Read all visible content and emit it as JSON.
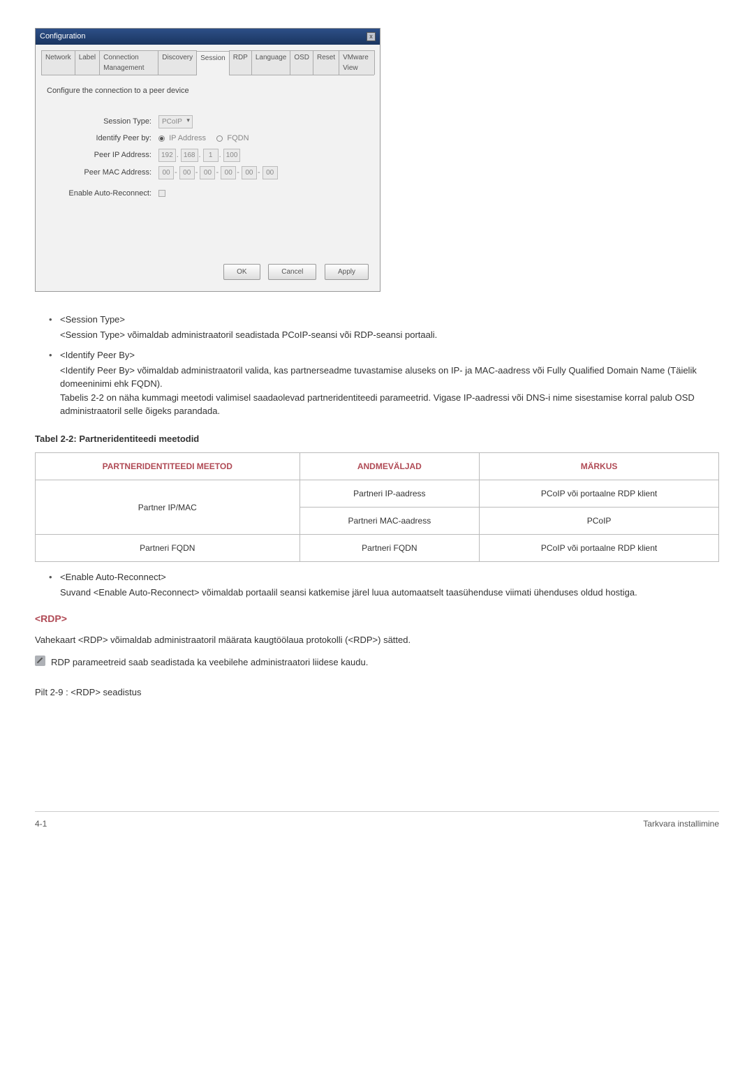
{
  "config_window": {
    "title": "Configuration",
    "tabs": [
      "Network",
      "Label",
      "Connection Management",
      "Discovery",
      "Session",
      "RDP",
      "Language",
      "OSD",
      "Reset",
      "VMware View"
    ],
    "active_tab_index": 4,
    "description": "Configure the connection to a peer device",
    "session_type": {
      "label": "Session Type:",
      "value": "PCoIP"
    },
    "identify_peer": {
      "label": "Identify Peer by:",
      "opt1": "IP Address",
      "opt2": "FQDN"
    },
    "peer_ip": {
      "label": "Peer IP Address:",
      "parts": [
        "192",
        "168",
        "1",
        "100"
      ]
    },
    "peer_mac": {
      "label": "Peer MAC Address:",
      "parts": [
        "00",
        "00",
        "00",
        "00",
        "00",
        "00"
      ]
    },
    "auto_reconnect": {
      "label": "Enable Auto-Reconnect:"
    },
    "buttons": {
      "ok": "OK",
      "cancel": "Cancel",
      "apply": "Apply"
    }
  },
  "bullets": {
    "session_type": {
      "title": "<Session Type>",
      "text": "<Session Type> võimaldab administraatoril seadistada PCoIP-seansi või RDP-seansi portaali."
    },
    "identify_peer": {
      "title": "<Identify Peer By>",
      "text1": "<Identify Peer By> võimaldab administraatoril valida, kas partnerseadme tuvastamise aluseks on IP- ja MAC-aadress või Fully Qualified Domain Name (Täielik domeeninimi ehk FQDN).",
      "text2": "Tabelis 2-2 on näha kummagi meetodi valimisel saadaolevad partneridentiteedi parameetrid. Vigase IP-aadressi või DNS-i nime sisestamise korral palub OSD administraatoril selle õigeks parandada."
    },
    "auto_reconnect": {
      "title": "<Enable Auto-Reconnect>",
      "text": "Suvand <Enable Auto-Reconnect> võimaldab portaalil seansi katkemise järel luua automaatselt taasühenduse viimati ühenduses oldud hostiga."
    }
  },
  "table": {
    "title": "Tabel 2-2: Partneridentiteedi meetodid",
    "headers": [
      "PARTNERIDENTITEEDI MEETOD",
      "ANDMEVÄLJAD",
      "MÄRKUS"
    ],
    "rows": [
      {
        "c0": "Partner IP/MAC",
        "c1": "Partneri IP-aadress",
        "c2": "PCoIP või portaalne RDP klient"
      },
      {
        "c0": "",
        "c1": "Partneri MAC-aadress",
        "c2": "PCoIP"
      },
      {
        "c0": "Partneri FQDN",
        "c1": "Partneri FQDN",
        "c2": "PCoIP või portaalne RDP klient"
      }
    ]
  },
  "rdp": {
    "heading": "<RDP>",
    "intro": "Vahekaart <RDP> võimaldab administraatoril määrata kaugtöölaua protokolli (<RDP>) sätted.",
    "note": "RDP parameetreid saab seadistada ka veebilehe administraatori liidese kaudu.",
    "figure": "Pilt  2-9 : <RDP> seadistus"
  },
  "footer": {
    "left": "4-1",
    "right": "Tarkvara installimine"
  }
}
